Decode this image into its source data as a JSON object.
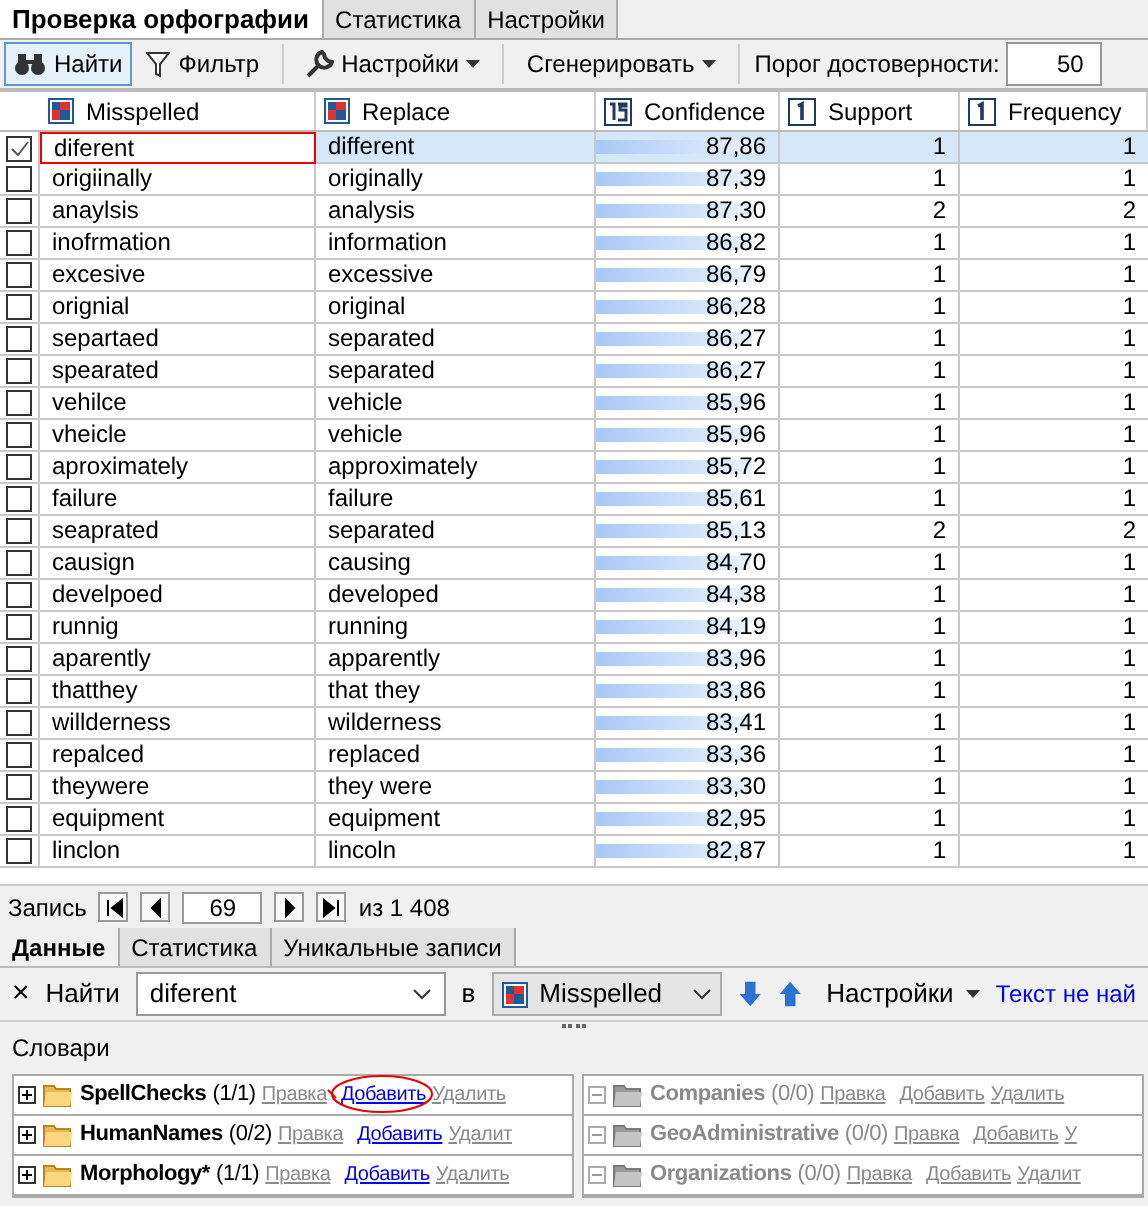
{
  "tabs": [
    {
      "label": "Проверка орфографии",
      "selected": true
    },
    {
      "label": "Статистика",
      "selected": false
    },
    {
      "label": "Настройки",
      "selected": false
    }
  ],
  "toolbar": {
    "find": "Найти",
    "filter": "Фильтр",
    "settings": "Настройки",
    "generate": "Сгенерировать",
    "threshold_label": "Порог достоверности:",
    "threshold_value": "50"
  },
  "table": {
    "columns": [
      {
        "label": "Misspelled",
        "kind": "text"
      },
      {
        "label": "Replace",
        "kind": "text"
      },
      {
        "label": "Confidence",
        "kind": "decimal"
      },
      {
        "label": "Support",
        "kind": "integer"
      },
      {
        "label": "Frequency",
        "kind": "integer"
      }
    ],
    "rows": [
      {
        "misspelled": "diferent",
        "replace": "different",
        "confidence": "87,86",
        "level": 0.88,
        "support": "1",
        "frequency": "1",
        "checked": true,
        "selected": true
      },
      {
        "misspelled": "origiinally",
        "replace": "originally",
        "confidence": "87,39",
        "level": 0.87,
        "support": "1",
        "frequency": "1",
        "checked": false,
        "selected": false
      },
      {
        "misspelled": "anaylsis",
        "replace": "analysis",
        "confidence": "87,30",
        "level": 0.87,
        "support": "2",
        "frequency": "2",
        "checked": false,
        "selected": false
      },
      {
        "misspelled": "inofrmation",
        "replace": "information",
        "confidence": "86,82",
        "level": 0.87,
        "support": "1",
        "frequency": "1",
        "checked": false,
        "selected": false
      },
      {
        "misspelled": "excesive",
        "replace": "excessive",
        "confidence": "86,79",
        "level": 0.87,
        "support": "1",
        "frequency": "1",
        "checked": false,
        "selected": false
      },
      {
        "misspelled": "orignial",
        "replace": "original",
        "confidence": "86,28",
        "level": 0.86,
        "support": "1",
        "frequency": "1",
        "checked": false,
        "selected": false
      },
      {
        "misspelled": "separtaed",
        "replace": "separated",
        "confidence": "86,27",
        "level": 0.86,
        "support": "1",
        "frequency": "1",
        "checked": false,
        "selected": false
      },
      {
        "misspelled": "spearated",
        "replace": "separated",
        "confidence": "86,27",
        "level": 0.86,
        "support": "1",
        "frequency": "1",
        "checked": false,
        "selected": false
      },
      {
        "misspelled": "vehilce",
        "replace": "vehicle",
        "confidence": "85,96",
        "level": 0.86,
        "support": "1",
        "frequency": "1",
        "checked": false,
        "selected": false
      },
      {
        "misspelled": "vheicle",
        "replace": "vehicle",
        "confidence": "85,96",
        "level": 0.86,
        "support": "1",
        "frequency": "1",
        "checked": false,
        "selected": false
      },
      {
        "misspelled": "aproximately",
        "replace": "approximately",
        "confidence": "85,72",
        "level": 0.86,
        "support": "1",
        "frequency": "1",
        "checked": false,
        "selected": false
      },
      {
        "misspelled": "failure",
        "replace": "failure",
        "confidence": "85,61",
        "level": 0.86,
        "support": "1",
        "frequency": "1",
        "checked": false,
        "selected": false
      },
      {
        "misspelled": "seaprated",
        "replace": "separated",
        "confidence": "85,13",
        "level": 0.85,
        "support": "2",
        "frequency": "2",
        "checked": false,
        "selected": false
      },
      {
        "misspelled": "causign",
        "replace": "causing",
        "confidence": "84,70",
        "level": 0.85,
        "support": "1",
        "frequency": "1",
        "checked": false,
        "selected": false
      },
      {
        "misspelled": "develpoed",
        "replace": "developed",
        "confidence": "84,38",
        "level": 0.84,
        "support": "1",
        "frequency": "1",
        "checked": false,
        "selected": false
      },
      {
        "misspelled": "runnig",
        "replace": "running",
        "confidence": "84,19",
        "level": 0.84,
        "support": "1",
        "frequency": "1",
        "checked": false,
        "selected": false
      },
      {
        "misspelled": "aparently",
        "replace": "apparently",
        "confidence": "83,96",
        "level": 0.84,
        "support": "1",
        "frequency": "1",
        "checked": false,
        "selected": false
      },
      {
        "misspelled": "thatthey",
        "replace": "that they",
        "confidence": "83,86",
        "level": 0.84,
        "support": "1",
        "frequency": "1",
        "checked": false,
        "selected": false
      },
      {
        "misspelled": "willderness",
        "replace": "wilderness",
        "confidence": "83,41",
        "level": 0.83,
        "support": "1",
        "frequency": "1",
        "checked": false,
        "selected": false
      },
      {
        "misspelled": "repalced",
        "replace": "replaced",
        "confidence": "83,36",
        "level": 0.83,
        "support": "1",
        "frequency": "1",
        "checked": false,
        "selected": false
      },
      {
        "misspelled": "theywere",
        "replace": "they were",
        "confidence": "83,30",
        "level": 0.83,
        "support": "1",
        "frequency": "1",
        "checked": false,
        "selected": false
      },
      {
        "misspelled": "equipment",
        "replace": "equipment",
        "confidence": "82,95",
        "level": 0.83,
        "support": "1",
        "frequency": "1",
        "checked": false,
        "selected": false
      },
      {
        "misspelled": "linclon",
        "replace": "lincoln",
        "confidence": "82,87",
        "level": 0.83,
        "support": "1",
        "frequency": "1",
        "checked": false,
        "selected": false
      }
    ]
  },
  "pager": {
    "label": "Запись",
    "current": "69",
    "total": "из 1 408"
  },
  "bottom_tabs": [
    {
      "label": "Данные",
      "selected": true
    },
    {
      "label": "Статистика",
      "selected": false
    },
    {
      "label": "Уникальные записи",
      "selected": false
    }
  ],
  "search": {
    "close": "×",
    "label": "Найти",
    "value": "diferent",
    "in_label": "в",
    "column": "Misspelled",
    "settings": "Настройки",
    "status": "Текст не най"
  },
  "dictionaries": {
    "title": "Словари",
    "left": [
      {
        "name": "SpellChecks",
        "count": "(1/1)",
        "edit": "Правка",
        "add": "Добавить",
        "delete": "Удалить",
        "enabled": true,
        "expanded": false,
        "circled": true
      },
      {
        "name": "HumanNames",
        "count": "(0/2)",
        "edit": "Правка",
        "add": "Добавить",
        "delete": "Удалит",
        "enabled": true,
        "expanded": false,
        "circled": false
      },
      {
        "name": "Morphology*",
        "count": "(1/1)",
        "edit": "Правка",
        "add": "Добавить",
        "delete": "Удалить",
        "enabled": true,
        "expanded": false,
        "circled": false
      }
    ],
    "right": [
      {
        "name": "Companies",
        "count": "(0/0)",
        "edit": "Правка",
        "add": "Добавить",
        "delete": "Удалить",
        "enabled": false,
        "expanded": true,
        "circled": false
      },
      {
        "name": "GeoAdministrative",
        "count": "(0/0)",
        "edit": "Правка",
        "add": "Добавить",
        "delete": "У",
        "enabled": false,
        "expanded": true,
        "circled": false
      },
      {
        "name": "Organizations",
        "count": "(0/0)",
        "edit": "Правка",
        "add": "Добавить",
        "delete": "Удалит",
        "enabled": false,
        "expanded": true,
        "circled": false
      }
    ]
  }
}
